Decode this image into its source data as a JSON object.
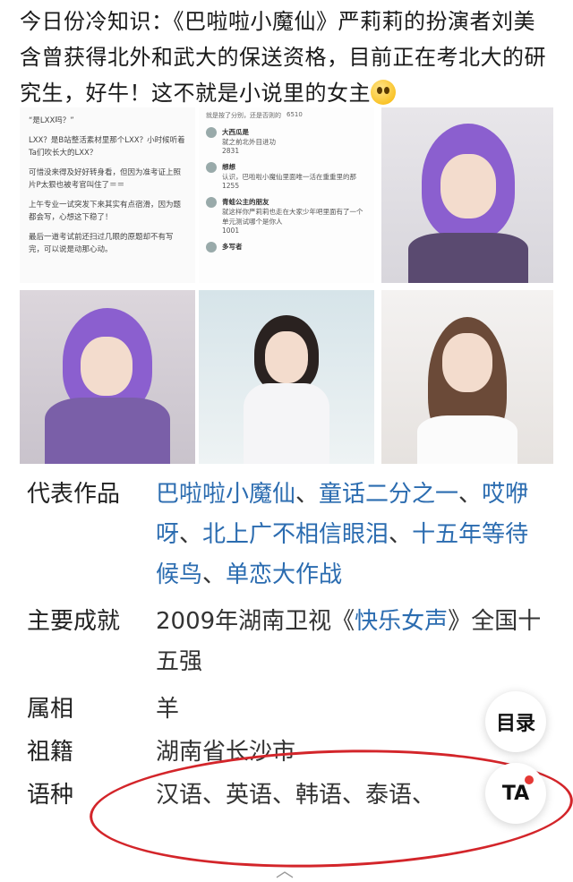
{
  "post": {
    "text": "今日份冷知识：《巴啦啦小魔仙》严莉莉的扮演者刘美含曾获得北外和武大的保送资格，目前正在考北大的研究生，好牛！这不就是小说里的女主"
  },
  "images": {
    "note_lines": [
      "“是LXX吗？”",
      "LXX？是B站整活素材里那个LXX？小时候听着Ta们吹长大的LXX？",
      "可惜没来得及好好转身看，但因为准考证上照片P太狠也被考官叫住了＝＝",
      "上午专业一试突发下来其实有点宿滑，因为题都会写，心想这下稳了！",
      "最后一道考试前还扫过几眼的原题却不有写完，可以说是动那心动。"
    ],
    "comments": [
      {
        "name": "大西瓜是",
        "text": "就之前北外目进功",
        "likes": "2831"
      },
      {
        "name": "想想",
        "text": "认识，巴啦啦小魔仙里面唯一活在重重里的那",
        "likes": "1255"
      },
      {
        "name": "青蛙公主的朋友",
        "text": "就这样你严莉莉也走在大家少年吧里面有了一个单元测试哪个是你人",
        "likes": "1001"
      }
    ],
    "comment_top_text": "就是按了分别，还是否则的",
    "comment_top_likes": "6510",
    "comment_more": "多写者"
  },
  "info": {
    "works_label": "代表作品",
    "works": [
      "巴啦啦小魔仙",
      "童话二分之一",
      "哎咿呀",
      "北上广不相信眼泪",
      "十五年等待候鸟",
      "单恋大作战"
    ],
    "works_sep": "、",
    "achievement_label": "主要成就",
    "achievement_pre": "2009年湖南卫视《",
    "achievement_link": "快乐女声",
    "achievement_post": "》全国十五强",
    "zodiac_label": "属相",
    "zodiac_value": "羊",
    "origin_label": "祖籍",
    "origin_value": "湖南省长沙市",
    "language_label": "语种",
    "language_value": "汉语、英语、韩语、泰语、"
  },
  "fab": {
    "toc_label": "目录",
    "ta_label": "TA"
  },
  "colors": {
    "link": "#2b6cb0",
    "annotation": "#d3252a"
  }
}
